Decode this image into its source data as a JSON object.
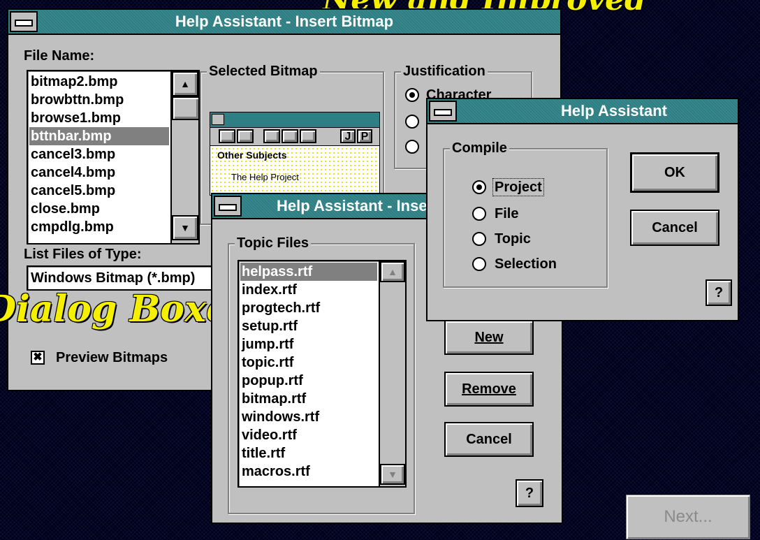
{
  "banner_top": "New and Improved",
  "banner_dialog": "Dialog Boxes",
  "colors": {
    "title_bar": "#2e7f84",
    "face": "#c0c0c0",
    "highlight": "#808080",
    "banner": "#f4f000",
    "background": "#000018"
  },
  "insert_bitmap": {
    "title": "Help Assistant - Insert Bitmap",
    "file_name_label": "File Name:",
    "files": [
      "bitmap2.bmp",
      "browbttn.bmp",
      "browse1.bmp",
      "bttnbar.bmp",
      "cancel3.bmp",
      "cancel4.bmp",
      "cancel5.bmp",
      "close.bmp",
      "cmpdlg.bmp"
    ],
    "selected_file": "bttnbar.bmp",
    "list_type_label": "List Files of Type:",
    "list_type_value": "Windows Bitmap (*.bmp)",
    "selected_bitmap_label": "Selected Bitmap",
    "preview_button_row": [
      "J",
      "P"
    ],
    "preview_line1": "Other Subjects",
    "preview_line2": "The Help Project",
    "justification_label": "Justification",
    "justification_option": "Character",
    "preview_checkbox_label": "Preview Bitmaps",
    "preview_checked": true
  },
  "topic_files_dialog": {
    "title": "Help Assistant - Insert Topic File",
    "group_label": "Topic Files",
    "files": [
      "helpass.rtf",
      "index.rtf",
      "progtech.rtf",
      "setup.rtf",
      "jump.rtf",
      "topic.rtf",
      "popup.rtf",
      "bitmap.rtf",
      "windows.rtf",
      "video.rtf",
      "title.rtf",
      "macros.rtf"
    ],
    "selected_file": "helpass.rtf",
    "new_button": "New",
    "remove_button": "Remove",
    "cancel_button": "Cancel",
    "help_button": "?"
  },
  "compile_dialog": {
    "title": "Help Assistant",
    "group_label": "Compile",
    "options": [
      "Project",
      "File",
      "Topic",
      "Selection"
    ],
    "selected_option": "Project",
    "ok_button": "OK",
    "cancel_button": "Cancel",
    "help_button": "?"
  },
  "next_button": "Next..."
}
